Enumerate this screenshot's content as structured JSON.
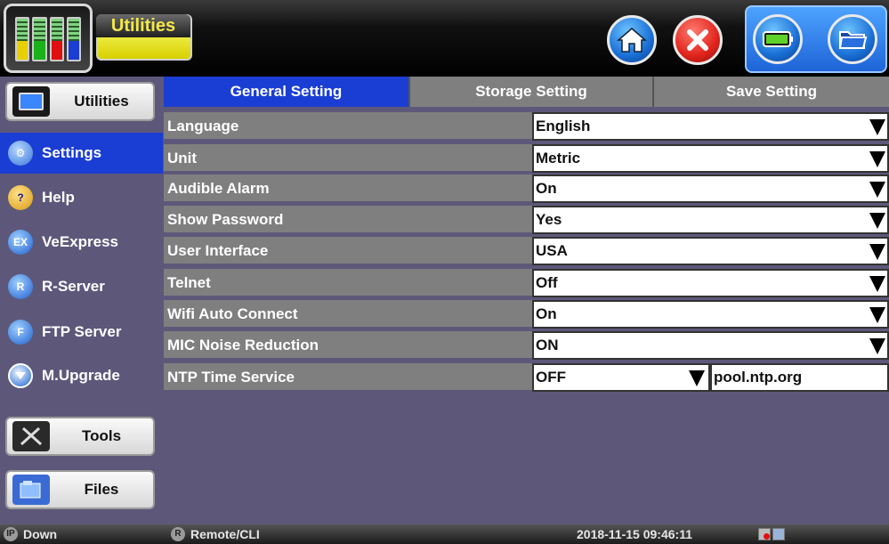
{
  "header": {
    "title": "Utilities",
    "buttons": [
      "home",
      "close",
      "battery",
      "folder"
    ]
  },
  "sidebar": {
    "top_button": "Utilities",
    "items": [
      {
        "label": "Settings",
        "icon": "gear-icon",
        "active": true
      },
      {
        "label": "Help",
        "icon": "help-icon"
      },
      {
        "label": "VeExpress",
        "icon": "veexpress-icon",
        "badge": "EX"
      },
      {
        "label": "R-Server",
        "icon": "r-server-icon",
        "badge": "R"
      },
      {
        "label": "FTP Server",
        "icon": "ftp-server-icon",
        "badge": "F"
      },
      {
        "label": "M.Upgrade",
        "icon": "upgrade-icon"
      }
    ],
    "tools_button": "Tools",
    "files_button": "Files"
  },
  "tabs": [
    {
      "label": "General Setting",
      "active": true
    },
    {
      "label": "Storage Setting",
      "active": false
    },
    {
      "label": "Save Setting",
      "active": false
    }
  ],
  "settings": [
    {
      "label": "Language",
      "value": "English"
    },
    {
      "label": "Unit",
      "value": "Metric"
    },
    {
      "label": "Audible Alarm",
      "value": "On"
    },
    {
      "label": "Show Password",
      "value": "Yes"
    },
    {
      "label": "User Interface",
      "value": "USA"
    },
    {
      "label": "Telnet",
      "value": "Off"
    },
    {
      "label": "Wifi Auto Connect",
      "value": "On"
    },
    {
      "label": "MIC Noise Reduction",
      "value": "ON"
    },
    {
      "label": "NTP Time Service",
      "value": "OFF",
      "server": "pool.ntp.org"
    }
  ],
  "status": {
    "ip_badge": "IP",
    "ip_status": "Down",
    "remote_badge": "R",
    "remote": "Remote/CLI",
    "datetime": "2018-11-15 09:46:11"
  }
}
